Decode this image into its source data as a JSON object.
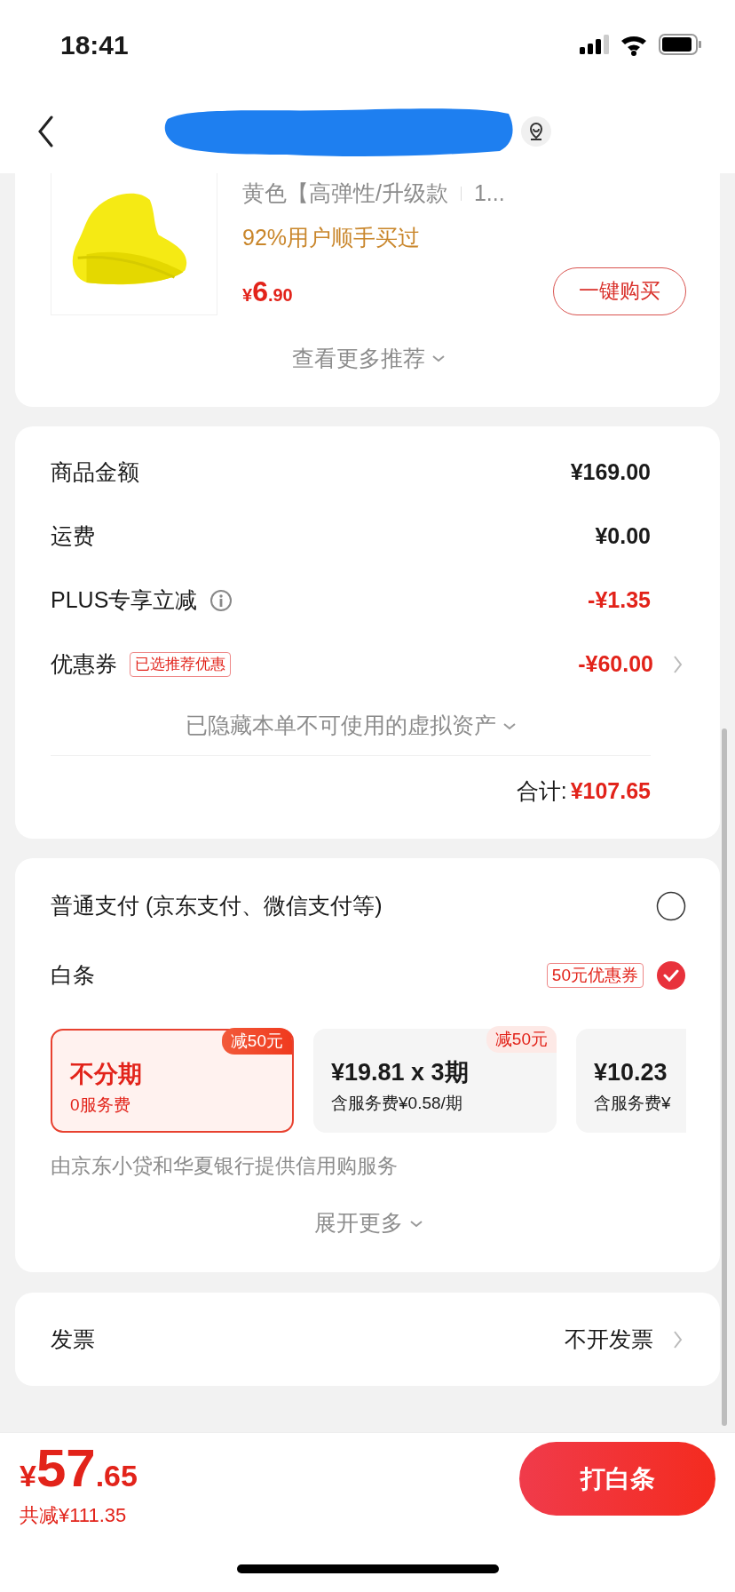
{
  "status_bar": {
    "time": "18:41"
  },
  "recommendation": {
    "spec": "黄色【高弹性/升级款",
    "quantity": "1...",
    "social_proof": "92%用户顺手买过",
    "price": {
      "symbol": "¥",
      "integer": "6",
      "decimal": ".90"
    },
    "buy_button": "一键购买",
    "more": "查看更多推荐"
  },
  "summary": {
    "rows": [
      {
        "label": "商品金额",
        "value": "¥169.00",
        "kind": "plain",
        "discount": false
      },
      {
        "label": "运费",
        "value": "¥0.00",
        "kind": "plain",
        "discount": false
      },
      {
        "label": "PLUS专享立减",
        "value": "-¥1.35",
        "kind": "info",
        "discount": true
      },
      {
        "label": "优惠券",
        "tag": "已选推荐优惠",
        "value": "-¥60.00",
        "kind": "link",
        "discount": true
      }
    ],
    "hidden_note": "已隐藏本单不可使用的虚拟资产",
    "total_label": "合计:",
    "total": "¥107.65"
  },
  "payment": {
    "options": [
      {
        "label": "普通支付 (京东支付、微信支付等)",
        "selected": false
      },
      {
        "label": "白条",
        "tag": "50元优惠券",
        "selected": true
      }
    ],
    "plans": [
      {
        "title": "不分期",
        "subtitle": "0服务费",
        "badge": "减50元",
        "selected": true
      },
      {
        "title": "¥19.81 x 3期",
        "subtitle": "含服务费¥0.58/期",
        "badge": "减50元",
        "selected": false
      },
      {
        "title": "¥10.23",
        "subtitle": "含服务费¥",
        "selected": false
      }
    ],
    "provider_note": "由京东小贷和华夏银行提供信用购服务",
    "expand": "展开更多"
  },
  "invoice": {
    "label": "发票",
    "value": "不开发票"
  },
  "footer": {
    "price": {
      "symbol": "¥",
      "integer": "57",
      "decimal": ".65"
    },
    "saved": "共减¥111.35",
    "pay_button": "打白条"
  }
}
